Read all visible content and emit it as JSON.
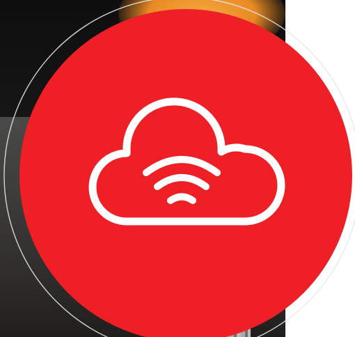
{
  "colors": {
    "badge": "#ef1f26",
    "icon_stroke": "#ffffff",
    "ring_stroke": "#e6e6e6"
  },
  "icon": "cloud-wifi-icon",
  "background": "photo-background"
}
